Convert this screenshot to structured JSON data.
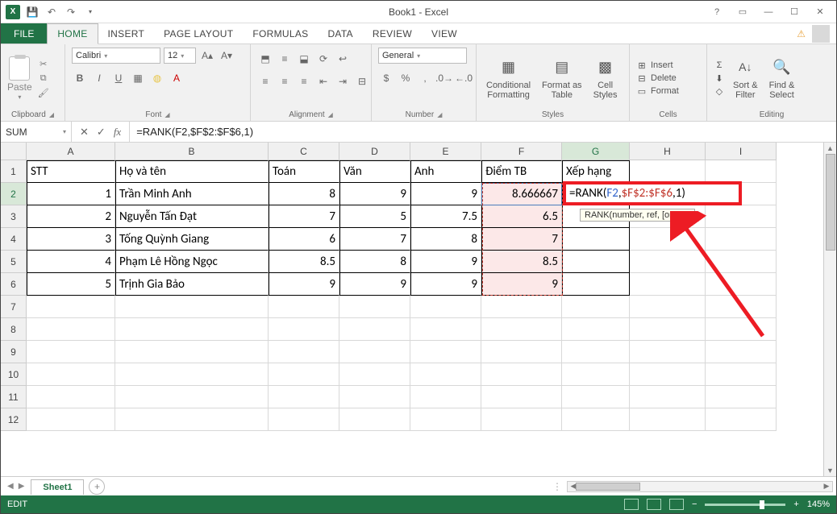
{
  "window": {
    "title": "Book1 - Excel"
  },
  "qat": {
    "save": "save-icon",
    "undo": "undo-icon",
    "redo": "redo-icon"
  },
  "tabs": {
    "file": "FILE",
    "items": [
      "HOME",
      "INSERT",
      "PAGE LAYOUT",
      "FORMULAS",
      "DATA",
      "REVIEW",
      "VIEW"
    ],
    "active": "HOME"
  },
  "ribbon": {
    "clipboard": {
      "label": "Clipboard",
      "paste": "Paste"
    },
    "font": {
      "label": "Font",
      "name": "Calibri",
      "size": "12",
      "buttons": {
        "bold": "B",
        "italic": "I",
        "underline": "U"
      }
    },
    "alignment": {
      "label": "Alignment"
    },
    "number": {
      "label": "Number",
      "format": "General"
    },
    "styles": {
      "label": "Styles",
      "cond": "Conditional\nFormatting",
      "table": "Format as\nTable",
      "cell": "Cell\nStyles"
    },
    "cells": {
      "label": "Cells",
      "insert": "Insert",
      "delete": "Delete",
      "format": "Format"
    },
    "editing": {
      "label": "Editing",
      "sort": "Sort &\nFilter",
      "find": "Find &\nSelect"
    }
  },
  "namebox": "SUM",
  "formula": "=RANK(F2,$F$2:$F$6,1)",
  "formula_tokens": {
    "fn": "=RANK(",
    "a1": "F2",
    "c1": ",",
    "a2": "$F$2:$F$6",
    "c2": ",",
    "a3": "1",
    "close": ")"
  },
  "tooltip": "RANK(number, ref, [order])",
  "columns": [
    "A",
    "B",
    "C",
    "D",
    "E",
    "F",
    "G",
    "H",
    "I"
  ],
  "row_numbers": [
    "1",
    "2",
    "3",
    "4",
    "5",
    "6",
    "7",
    "8",
    "9",
    "10",
    "11",
    "12"
  ],
  "headers": {
    "A": "STT",
    "B": "Họ và tên",
    "C": "Toán",
    "D": "Văn",
    "E": "Anh",
    "F": "Điểm TB",
    "G": "Xếp hạng"
  },
  "rows": [
    {
      "stt": "1",
      "name": "Trần Minh Anh",
      "c": "8",
      "d": "9",
      "e": "9",
      "f": "8.666667"
    },
    {
      "stt": "2",
      "name": "Nguyễn Tấn Đạt",
      "c": "7",
      "d": "5",
      "e": "7.5",
      "f": "6.5"
    },
    {
      "stt": "3",
      "name": "Tống Quỳnh Giang",
      "c": "6",
      "d": "7",
      "e": "8",
      "f": "7"
    },
    {
      "stt": "4",
      "name": "Phạm Lê Hồng Ngọc",
      "c": "8.5",
      "d": "8",
      "e": "9",
      "f": "8.5"
    },
    {
      "stt": "5",
      "name": "Trịnh Gia Bảo",
      "c": "9",
      "d": "9",
      "e": "9",
      "f": "9"
    }
  ],
  "sheet": {
    "name": "Sheet1"
  },
  "status": {
    "mode": "EDIT",
    "zoom": "145%"
  }
}
